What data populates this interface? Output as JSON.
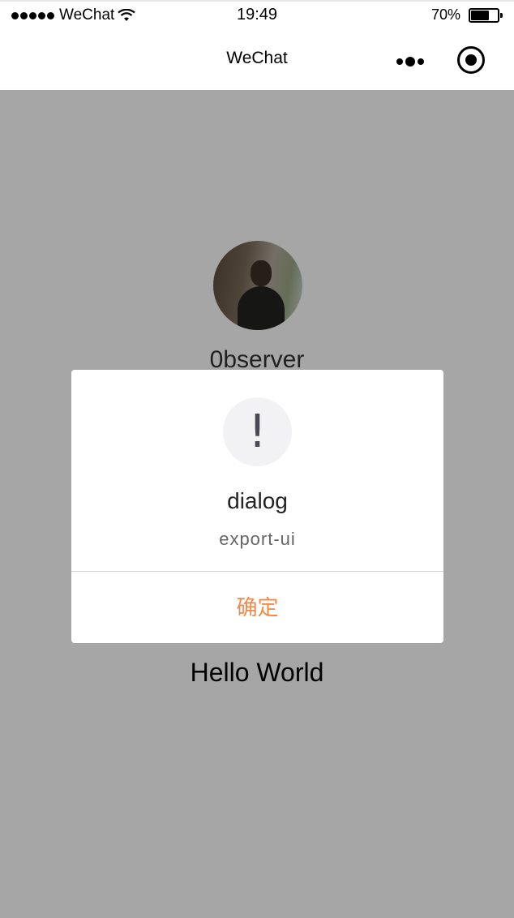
{
  "status_bar": {
    "carrier": "WeChat",
    "time": "19:49",
    "battery_percent": "70%",
    "battery_level": 0.7
  },
  "nav": {
    "title": "WeChat",
    "more_icon": "more-dots-icon",
    "close_icon": "capsule-close-icon"
  },
  "page": {
    "username": "0bserver",
    "greeting": "Hello World"
  },
  "dialog": {
    "icon_glyph": "!",
    "title": "dialog",
    "content": "export-ui",
    "confirm_label": "确定",
    "confirm_color": "#f08a4b"
  }
}
